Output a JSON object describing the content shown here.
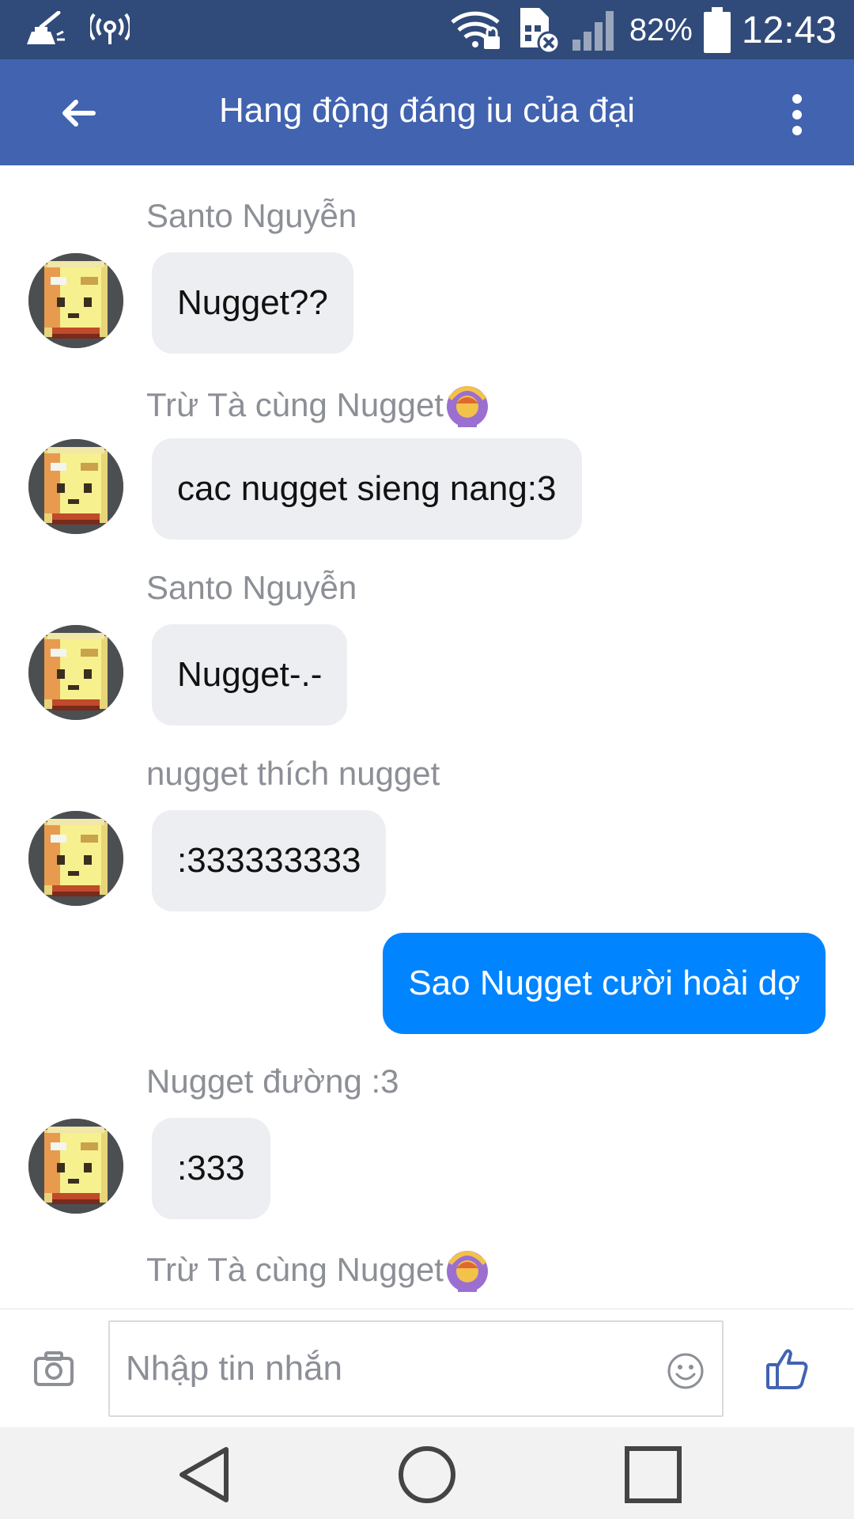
{
  "status_bar": {
    "battery_percent": "82%",
    "time": "12:43",
    "icons": [
      "cleaner-icon",
      "hotspot-icon",
      "wifi-lock-icon",
      "sim-error-icon",
      "signal-icon",
      "battery-icon"
    ]
  },
  "header": {
    "title": "Hang động đáng iu của đại",
    "icons": [
      "back-arrow-icon",
      "more-vert-icon"
    ]
  },
  "messages": [
    {
      "sender": "Santo Nguyễn",
      "text": "Nugget??",
      "direction": "incoming"
    },
    {
      "sender": "Trừ Tà cùng Nugget",
      "sender_emoji": "woman-gesturing-ok-icon",
      "text": "cac nugget sieng nang:3",
      "direction": "incoming"
    },
    {
      "sender": "Santo Nguyễn",
      "text": "Nugget-.-",
      "direction": "incoming"
    },
    {
      "sender": "nugget thích nugget",
      "text": ":333333333",
      "direction": "incoming"
    },
    {
      "text": "Sao Nugget cười hoài dợ",
      "direction": "outgoing"
    },
    {
      "sender": "Nugget đường :3",
      "text": ":333",
      "direction": "incoming"
    },
    {
      "sender": "Trừ Tà cùng Nugget",
      "sender_emoji": "woman-gesturing-ok-icon",
      "direction": "incoming"
    }
  ],
  "composer": {
    "placeholder": "Nhập tin nhắn",
    "icons": [
      "camera-icon",
      "smiley-icon",
      "thumbs-up-icon"
    ]
  },
  "nav_bar": {
    "icons": [
      "back-triangle-icon",
      "home-circle-icon",
      "recents-square-icon"
    ]
  },
  "colors": {
    "status_bar": "#304a7a",
    "app_bar": "#4163b0",
    "outgoing_bubble": "#0084ff",
    "incoming_bubble": "#eceef1",
    "sender_text": "#8c8f96",
    "like_icon": "#4163b0"
  }
}
